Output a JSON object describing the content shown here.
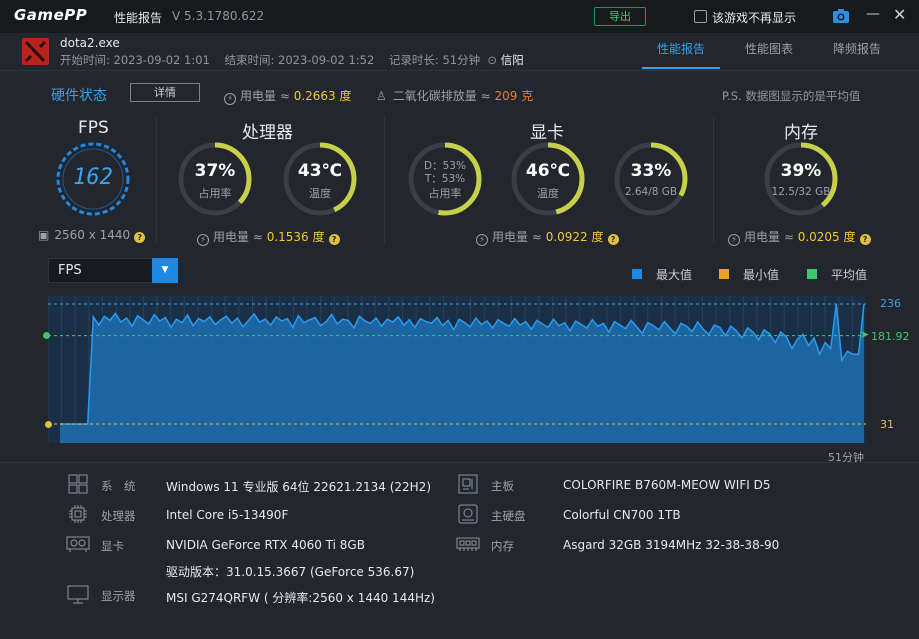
{
  "app": {
    "logo": "GamePP",
    "title": "性能报告",
    "version": "V 5.3.1780.622",
    "export_label": "导出",
    "no_show_label": "该游戏不再显示"
  },
  "game": {
    "name": "dota2.exe",
    "start_label": "开始时间:",
    "start": "2023-09-02 1:01",
    "end_label": "结束时间:",
    "end": "2023-09-02 1:52",
    "duration_label": "记录时长:",
    "duration": "51分钟",
    "location": "信阳"
  },
  "tabs": [
    "性能报告",
    "性能图表",
    "降频报告"
  ],
  "hardware": {
    "title": "硬件状态",
    "detail_button": "详情",
    "total_power_label": "用电量 ≈",
    "total_power": "0.2663 度",
    "co2_label": "二氧化碳排放量 ≈",
    "co2": "209 克",
    "note": "P.S. 数据图显示的是平均值"
  },
  "fps_panel": {
    "title": "FPS",
    "value": "162",
    "resolution": "2560 x 1440"
  },
  "cpu_panel": {
    "title": "处理器",
    "usage": "37%",
    "usage_label": "占用率",
    "usage_frac": 0.37,
    "temp": "43℃",
    "temp_label": "温度",
    "temp_frac": 0.43,
    "power_label": "用电量 ≈",
    "power": "0.1536 度"
  },
  "gpu_panel": {
    "title": "显卡",
    "d_line": "D：53%",
    "t_line": "T：53%",
    "usage_label": "占用率",
    "usage_frac": 0.53,
    "temp": "46℃",
    "temp_label": "温度",
    "temp_frac": 0.46,
    "vram": "33%",
    "vram_sub": "2.64/8 GB",
    "vram_frac": 0.33,
    "power_label": "用电量 ≈",
    "power": "0.0922 度"
  },
  "mem_panel": {
    "title": "内存",
    "usage": "39%",
    "usage_sub": "12.5/32 GB",
    "usage_frac": 0.39,
    "power_label": "用电量 ≈",
    "power": "0.0205 度"
  },
  "chart_controls": {
    "metric": "FPS",
    "legend": [
      {
        "label": "最大值",
        "color": "#1e88e5"
      },
      {
        "label": "最小值",
        "color": "#f0a020"
      },
      {
        "label": "平均值",
        "color": "#43c46d"
      }
    ]
  },
  "chart_data": {
    "type": "area",
    "series": [
      {
        "name": "FPS",
        "values": [
          31,
          31,
          31,
          31,
          31,
          31,
          214,
          200,
          215,
          208,
          220,
          205,
          212,
          198,
          216,
          209,
          202,
          218,
          207,
          213,
          196,
          210,
          204,
          217,
          199,
          211,
          206,
          214,
          201,
          209,
          215,
          203,
          212,
          197,
          208,
          219,
          205,
          210,
          200,
          214,
          207,
          211,
          196,
          216,
          204,
          209,
          213,
          199,
          206,
          218,
          202,
          210,
          208,
          195,
          215,
          207,
          203,
          212,
          198,
          210,
          205,
          214,
          200,
          209,
          196,
          211,
          206,
          203,
          213,
          199,
          208,
          192,
          210,
          204,
          197,
          212,
          201,
          207,
          195,
          209,
          203,
          198,
          211,
          200,
          206,
          193,
          208,
          202,
          196,
          210,
          199,
          204,
          190,
          207,
          201,
          195,
          209,
          198,
          203,
          188,
          206,
          200,
          194,
          208,
          197,
          186,
          204,
          199,
          192,
          206,
          195,
          185,
          203,
          198,
          189,
          205,
          193,
          184,
          200,
          196,
          182,
          198,
          190,
          178,
          195,
          188,
          175,
          192,
          185,
          170,
          188,
          180,
          160,
          176,
          184,
          165,
          178,
          150,
          170,
          160,
          236,
          140,
          155,
          150,
          150,
          236
        ]
      }
    ],
    "ymax": 236,
    "ymin": 31,
    "avg": 181.92,
    "axis_labels": {
      "max": "236",
      "avg": "181.92",
      "min": "31"
    },
    "xlabel": "51分钟"
  },
  "specs": {
    "os_label": "系　统",
    "os": "Windows 11 专业版 64位 22621.2134 (22H2)",
    "cpu_label": "处理器",
    "cpu": "Intel Core i5-13490F",
    "gpu_label": "显卡",
    "gpu": "NVIDIA GeForce RTX 4060 Ti 8GB",
    "driver": "驱动版本：31.0.15.3667 (GeForce 536.67)",
    "monitor_label": "显示器",
    "monitor": "MSI G274QRFW ( 分辨率:2560 x 1440 144Hz)",
    "board_label": "主板",
    "board": "COLORFIRE B760M-MEOW WIFI D5",
    "disk_label": "主硬盘",
    "disk": "Colorful CN700 1TB",
    "ram_label": "内存",
    "ram": "Asgard 32GB 3194MHz 32-38-38-90"
  },
  "colors": {
    "accent": "#3a9ee8",
    "gauge_track": "#3a3e46",
    "gauge_fill": "#c8d04a",
    "fps_ring": "#1e88e5",
    "panel_bg": "#23262c"
  }
}
